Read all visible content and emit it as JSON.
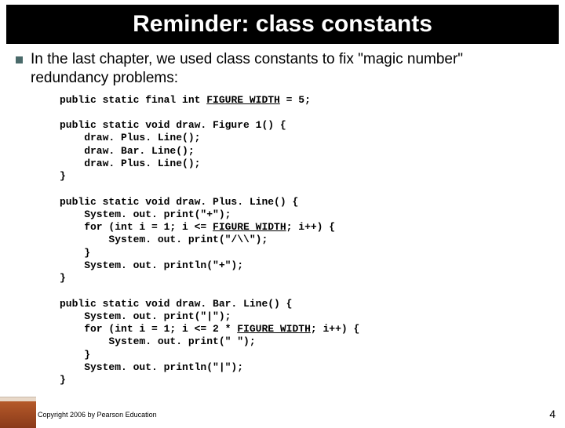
{
  "title": "Reminder: class constants",
  "bullet": "In the last chapter, we used class constants to fix \"magic number\" redundancy problems:",
  "code": {
    "l01": "public static final int ",
    "l01u": "FIGURE_WIDTH",
    "l01b": " = 5;",
    "l02": "",
    "l03": "public static void draw. Figure 1() {",
    "l04": "    draw. Plus. Line();",
    "l05": "    draw. Bar. Line();",
    "l06": "    draw. Plus. Line();",
    "l07": "}",
    "l08": "",
    "l09": "public static void draw. Plus. Line() {",
    "l10": "    System. out. print(\"+\");",
    "l11": "    for (int i = 1; i <= ",
    "l11u": "FIGURE_WIDTH",
    "l11b": "; i++) {",
    "l12": "        System. out. print(\"/\\\\\");",
    "l13": "    }",
    "l14": "    System. out. println(\"+\");",
    "l15": "}",
    "l16": "",
    "l17": "public static void draw. Bar. Line() {",
    "l18": "    System. out. print(\"|\");",
    "l19": "    for (int i = 1; i <= 2 * ",
    "l19u": "FIGURE_WIDTH",
    "l19b": "; i++) {",
    "l20": "        System. out. print(\" \");",
    "l21": "    }",
    "l22": "    System. out. println(\"|\");",
    "l23": "}"
  },
  "footer": "Copyright 2006 by Pearson Education",
  "page_number": "4"
}
